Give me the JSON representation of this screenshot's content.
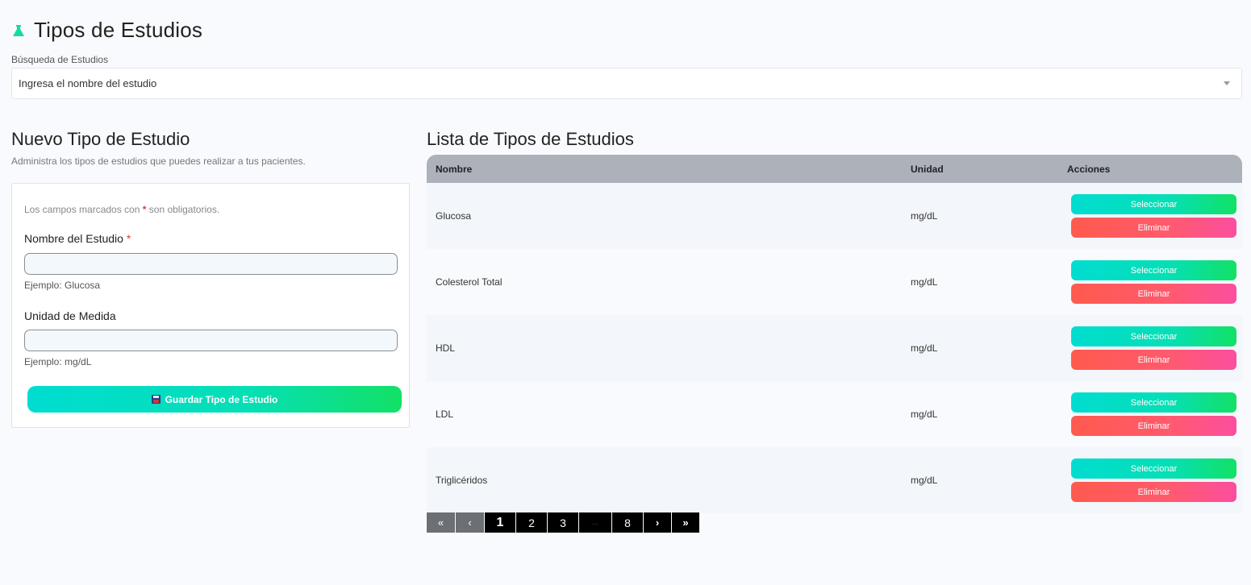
{
  "header": {
    "title": "Tipos de Estudios",
    "icon": "flask-icon"
  },
  "search": {
    "label": "Búsqueda de Estudios",
    "placeholder": "Ingresa el nombre del estudio"
  },
  "form": {
    "title": "Nuevo Tipo de Estudio",
    "subtitle": "Administra los tipos de estudios que puedes realizar a tus pacientes.",
    "required_note_prefix": "Los campos marcados con",
    "required_star": "*",
    "required_note_suffix": "son obligatorios.",
    "name_label": "Nombre del Estudio",
    "name_star": "*",
    "name_value": "",
    "name_help": "Ejemplo: Glucosa",
    "unit_label": "Unidad de Medida",
    "unit_value": "",
    "unit_help": "Ejemplo: mg/dL",
    "save_label": "Guardar Tipo de Estudio"
  },
  "list": {
    "title": "Lista de Tipos de Estudios",
    "columns": {
      "name": "Nombre",
      "unit": "Unidad",
      "actions": "Acciones"
    },
    "rows": [
      {
        "name": "Glucosa",
        "unit": "mg/dL"
      },
      {
        "name": "Colesterol Total",
        "unit": "mg/dL"
      },
      {
        "name": "HDL",
        "unit": "mg/dL"
      },
      {
        "name": "LDL",
        "unit": "mg/dL"
      },
      {
        "name": "Triglicéridos",
        "unit": "mg/dL"
      }
    ],
    "select_label": "Seleccionar",
    "delete_label": "Eliminar"
  },
  "pagination": {
    "first": "«",
    "prev": "‹",
    "pages": [
      "1",
      "2",
      "3"
    ],
    "ellipsis": "...",
    "last_page": "8",
    "next": "›",
    "last": "»",
    "current": "1"
  },
  "colors": {
    "accent_green": "#06dfb5",
    "danger": "#ff5a6e",
    "table_header": "#acb1ba"
  }
}
